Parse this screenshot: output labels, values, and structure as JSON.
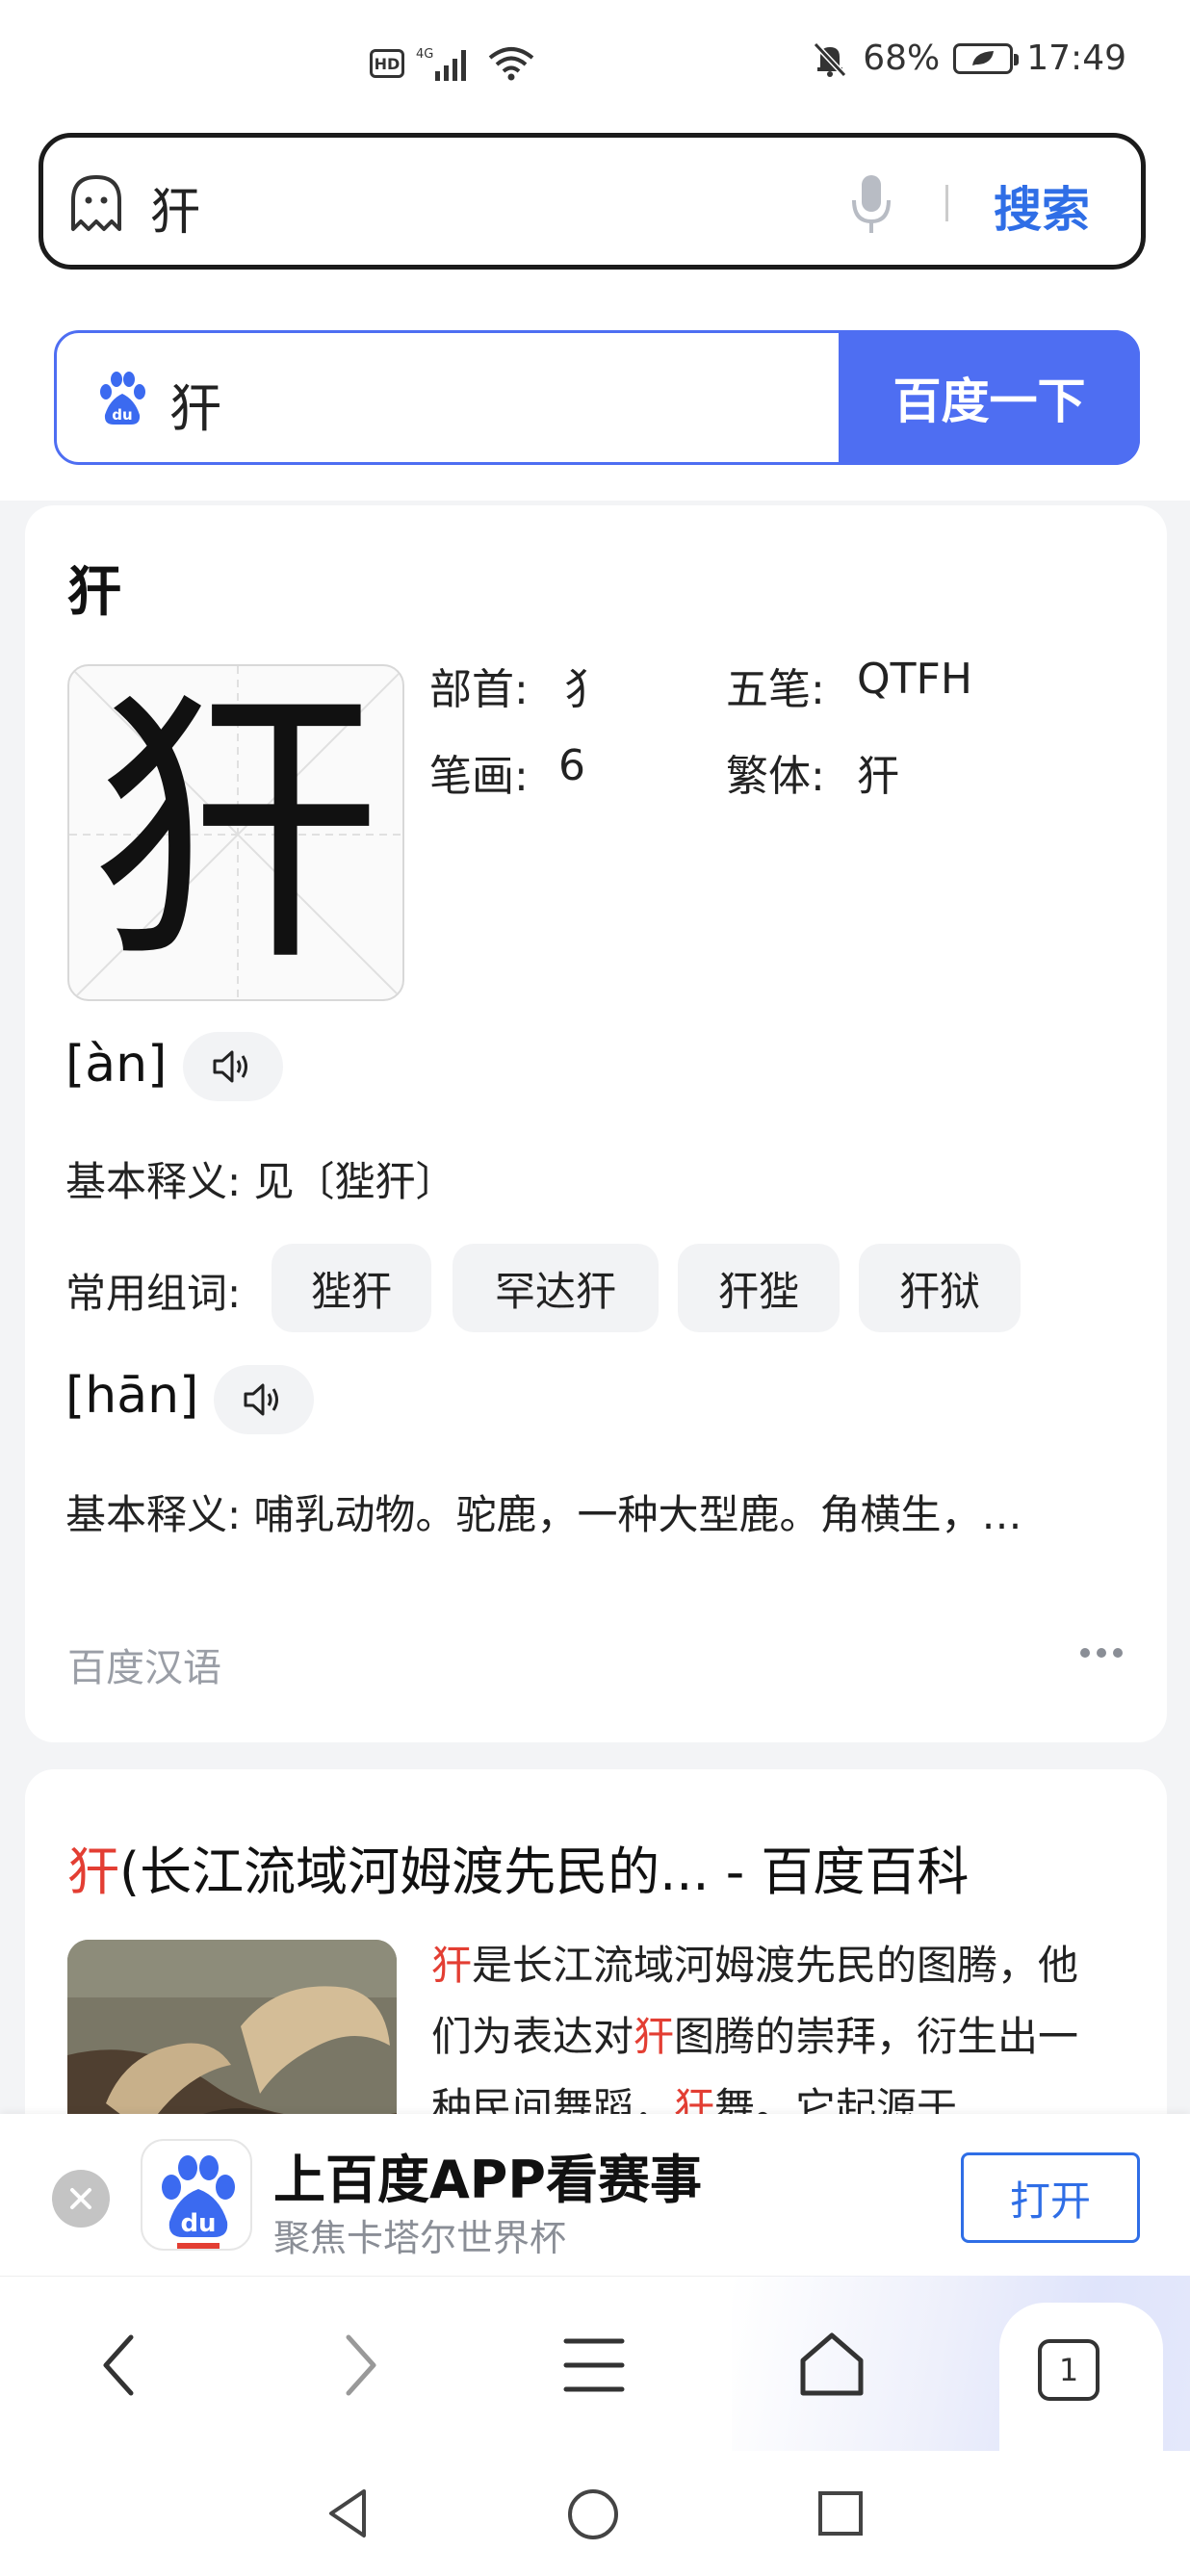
{
  "status_bar": {
    "network": "4G",
    "hd": "HD",
    "battery": "68%",
    "time": "17:49"
  },
  "browser": {
    "query": "犴",
    "search_label": "搜索"
  },
  "baidu_search": {
    "query": "犴",
    "button_label": "百度一下"
  },
  "dict_card": {
    "title": "犴",
    "character": "犴",
    "radical_label": "部首:",
    "radical_value": "犭",
    "wubi_label": "五笔:",
    "wubi_value": "QTFH",
    "strokes_label": "笔画:",
    "strokes_value": "6",
    "traditional_label": "繁体:",
    "traditional_value": "犴",
    "readings": [
      {
        "pinyin": "[àn]",
        "definition_label": "基本释义:",
        "definition": "见〔狴犴〕",
        "words_label": "常用组词:",
        "words": [
          "狴犴",
          "罕达犴",
          "犴狴",
          "犴狱"
        ]
      },
      {
        "pinyin": "[hān]",
        "definition_label": "基本释义:",
        "definition": "哺乳动物。驼鹿，一种大型鹿。角横生，…"
      }
    ],
    "source": "百度汉语"
  },
  "baike_card": {
    "title_highlight": "犴",
    "title_rest": "(长江流域河姆渡先民的... - 百度百科",
    "snippet": [
      {
        "text": "犴",
        "hl": true
      },
      {
        "text": "是长江流域河姆渡先民的图腾，他们为表达对",
        "hl": false
      },
      {
        "text": "犴",
        "hl": true
      },
      {
        "text": "图腾的崇拜，衍生出一种民间舞蹈，",
        "hl": false
      },
      {
        "text": "犴",
        "hl": true
      },
      {
        "text": "舞。它起源于",
        "hl": false
      }
    ]
  },
  "app_banner": {
    "title": "上百度APP看赛事",
    "subtitle": "聚焦卡塔尔世界杯",
    "button_label": "打开",
    "logo_text": "du"
  },
  "bottom_nav": {
    "tab_count": "1"
  },
  "colors": {
    "accent_blue": "#4e6ef2",
    "link_blue": "#2f6ee6",
    "highlight_red": "#e33e33"
  }
}
